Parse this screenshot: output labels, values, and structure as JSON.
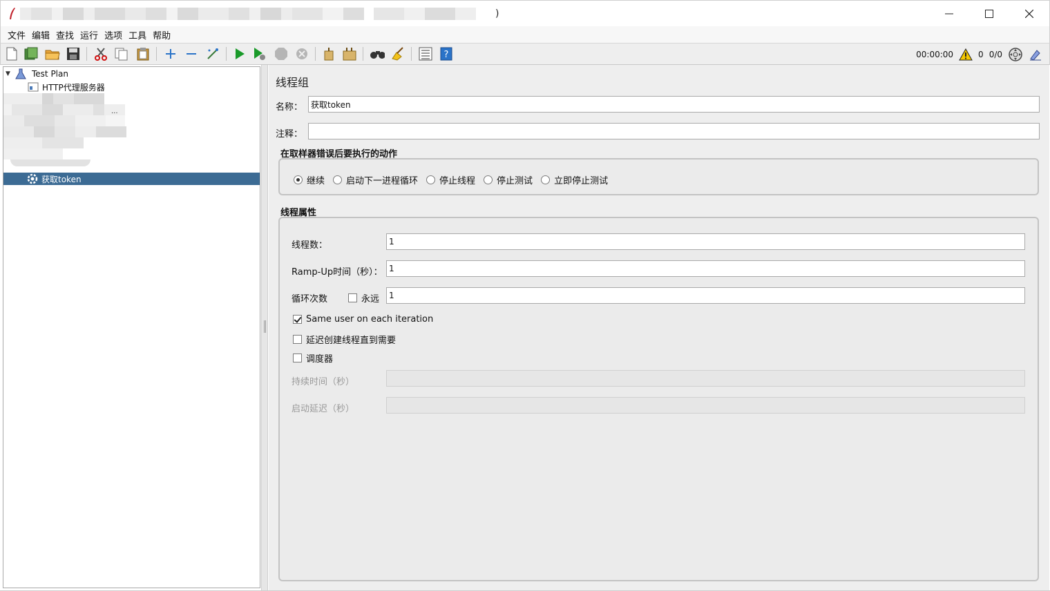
{
  "window": {
    "title_suffix": ")"
  },
  "menu": [
    "文件",
    "编辑",
    "查找",
    "运行",
    "选项",
    "工具",
    "帮助"
  ],
  "toolbar": {
    "elapsed_time": "00:00:00",
    "warning_count": "0",
    "thread_ratio": "0/0"
  },
  "tree": {
    "root": "Test Plan",
    "proxy": "HTTP代理服务器",
    "selected": "获取token",
    "ellipsis": "..."
  },
  "panel": {
    "title": "线程组",
    "name_label": "名称：",
    "name_value": "获取token",
    "comment_label": "注释：",
    "comment_value": "",
    "error_section": "在取样器错误后要执行的动作",
    "error_actions": [
      "继续",
      "启动下一进程循环",
      "停止线程",
      "停止测试",
      "立即停止测试"
    ],
    "thread_section": "线程属性",
    "threads_label": "线程数：",
    "threads_value": "1",
    "rampup_label": "Ramp-Up时间（秒）：",
    "rampup_value": "1",
    "loop_label": "循环次数",
    "forever_label": "永远",
    "loop_value": "1",
    "same_user_label": "Same user on each iteration",
    "delay_create_label": "延迟创建线程直到需要",
    "scheduler_label": "调度器",
    "duration_label": "持续时间（秒）",
    "startup_delay_label": "启动延迟（秒）"
  },
  "colors": {
    "selection": "#3c6b94",
    "run_green": "#1a9a2a",
    "add_blue": "#2a73c8"
  }
}
